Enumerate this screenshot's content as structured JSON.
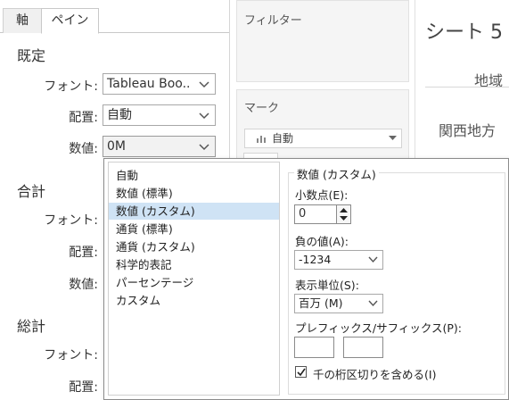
{
  "tabs": [
    "軸",
    "ペイン"
  ],
  "sections": {
    "default": {
      "title": "既定",
      "font_label": "フォント:",
      "font_value": "Tableau Boo..",
      "align_label": "配置:",
      "align_value": "自動",
      "number_label": "数値:",
      "number_value": "0M"
    },
    "total": {
      "title": "合計",
      "font_label": "フォント:",
      "align_label": "配置:",
      "number_label": "数値:"
    },
    "grand_total": {
      "title": "総計",
      "font_label": "フォント:",
      "align_label": "配置:"
    }
  },
  "shelves": {
    "filters_title": "フィルター",
    "marks_title": "マーク",
    "marks_type": "自動"
  },
  "sheet": {
    "title": "シート 5",
    "header": "地域",
    "row_label": "関西地方"
  },
  "popup": {
    "list_items": [
      "自動",
      "数値 (標準)",
      "数値 (カスタム)",
      "通貨 (標準)",
      "通貨 (カスタム)",
      "科学的表記",
      "パーセンテージ",
      "カスタム"
    ],
    "selected_index": 2,
    "group_title": "数値 (カスタム)",
    "decimals_label": "小数点(E):",
    "decimals_value": "0",
    "negative_label": "負の値(A):",
    "negative_value": "-1234",
    "units_label": "表示単位(S):",
    "units_value": "百万 (M)",
    "prefix_suffix_label": "プレフィックス/サフィックス(P):",
    "prefix_value": "",
    "suffix_value": "",
    "thousands_label": "千の桁区切りを含める(I)",
    "thousands_checked": true
  },
  "colors": {
    "selection": "#cfe3f5",
    "panel_bg": "#f5f5f5"
  }
}
